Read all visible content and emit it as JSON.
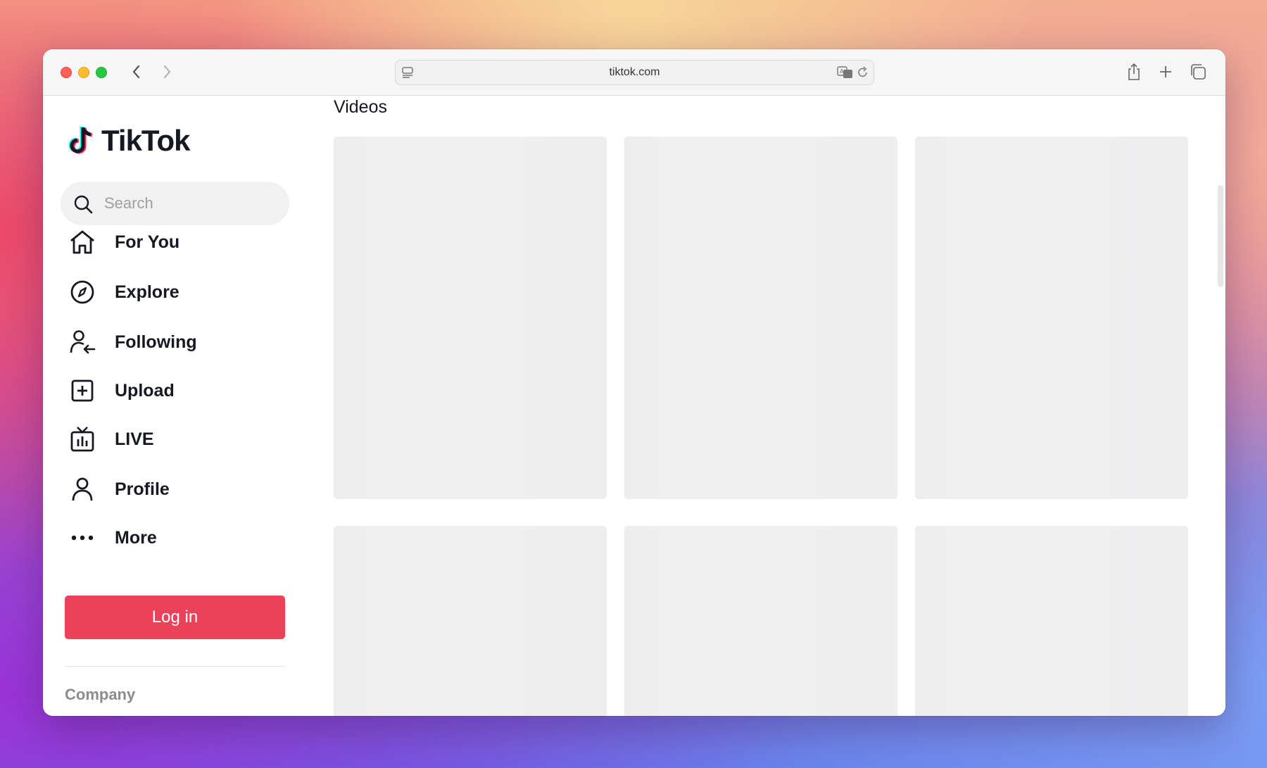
{
  "browser": {
    "url": "tiktok.com"
  },
  "sidebar": {
    "logo_text": "TikTok",
    "search_placeholder": "Search",
    "items": [
      {
        "label": "For You",
        "icon": "home-icon"
      },
      {
        "label": "Explore",
        "icon": "compass-icon"
      },
      {
        "label": "Following",
        "icon": "following-icon"
      },
      {
        "label": "Upload",
        "icon": "upload-icon"
      },
      {
        "label": "LIVE",
        "icon": "live-tv-icon"
      },
      {
        "label": "Profile",
        "icon": "profile-icon"
      },
      {
        "label": "More",
        "icon": "more-icon"
      }
    ],
    "login_label": "Log in",
    "company_label": "Company"
  },
  "main": {
    "section_title": "Videos",
    "video_placeholders": 6
  },
  "colors": {
    "login_button": "#ea4359",
    "text_primary": "#161823",
    "placeholder_card": "#efeff0"
  }
}
